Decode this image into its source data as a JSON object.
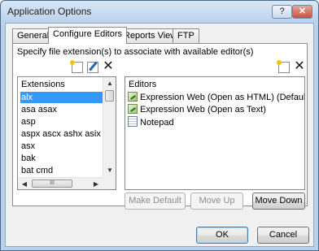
{
  "window": {
    "title": "Application Options",
    "help_label": "?",
    "close_label": "✕"
  },
  "tabs": [
    {
      "label": "General",
      "active": false
    },
    {
      "label": "Configure Editors",
      "active": true
    },
    {
      "label": "Reports View",
      "active": false
    },
    {
      "label": "FTP",
      "active": false
    }
  ],
  "panel": {
    "description": "Specify file extension(s) to associate with available editor(s)"
  },
  "extensions": {
    "header": "Extensions",
    "items": [
      "alx",
      "asa asax",
      "asp",
      "aspx ascx ashx asix as",
      "asx",
      "bak",
      "bat cmd"
    ],
    "selected": "alx",
    "hscroll_thumb_glyph": "III"
  },
  "editors": {
    "header": "Editors",
    "items": [
      {
        "label": "Expression Web (Open as HTML) (Default)",
        "icon": "expression-web-icon"
      },
      {
        "label": "Expression Web (Open as Text)",
        "icon": "expression-web-icon"
      },
      {
        "label": "Notepad",
        "icon": "notepad-icon"
      }
    ]
  },
  "editor_buttons": {
    "make_default": "Make Default",
    "move_up": "Move Up",
    "move_down": "Move Down"
  },
  "dialog_buttons": {
    "ok": "OK",
    "cancel": "Cancel"
  },
  "icons": {
    "add": "new-document-icon",
    "edit": "edit-icon",
    "delete": "delete-x-icon"
  }
}
